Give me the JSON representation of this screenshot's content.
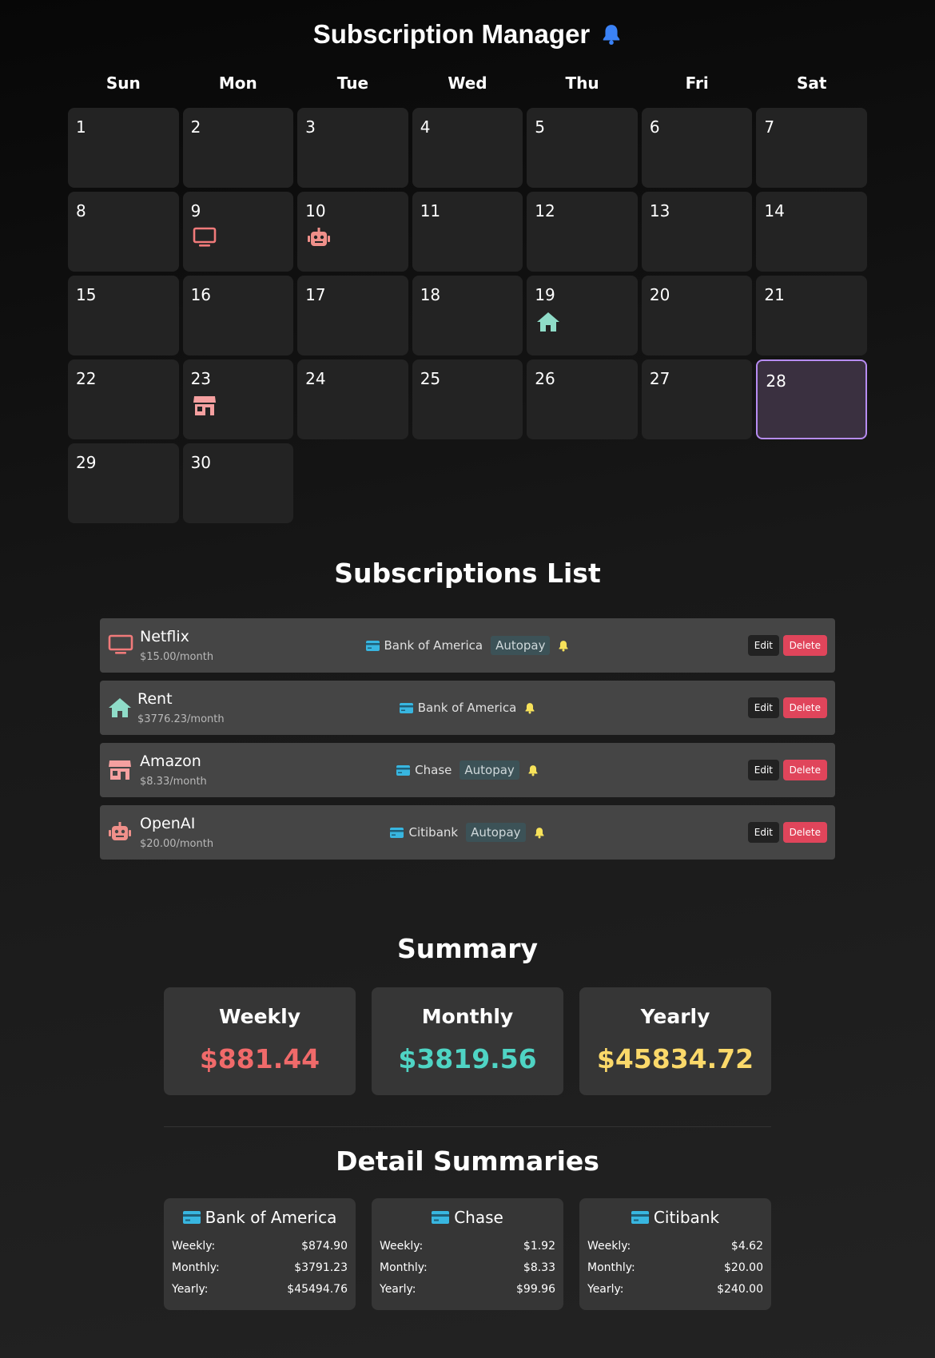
{
  "app": {
    "title": "Subscription Manager"
  },
  "calendar": {
    "weekdays": [
      "Sun",
      "Mon",
      "Tue",
      "Wed",
      "Thu",
      "Fri",
      "Sat"
    ],
    "days": [
      "1",
      "2",
      "3",
      "4",
      "5",
      "6",
      "7",
      "8",
      "9",
      "10",
      "11",
      "12",
      "13",
      "14",
      "15",
      "16",
      "17",
      "18",
      "19",
      "20",
      "21",
      "22",
      "23",
      "24",
      "25",
      "26",
      "27",
      "28",
      "29",
      "30"
    ],
    "events": [
      {
        "day": "9",
        "icon": "tv-icon",
        "color": "#f07a7a"
      },
      {
        "day": "10",
        "icon": "robot-icon",
        "color": "#f0908a"
      },
      {
        "day": "19",
        "icon": "home-icon",
        "color": "#8fdcc8"
      },
      {
        "day": "23",
        "icon": "store-icon",
        "color": "#f5a0a0"
      }
    ],
    "today": "28"
  },
  "subscriptions": {
    "title": "Subscriptions List",
    "items": [
      {
        "name": "Netflix",
        "price": "$15.00/month",
        "bank": "Bank of America",
        "autopay": "Autopay",
        "icon": "tv-icon",
        "icon_color": "#f07a7a"
      },
      {
        "name": "Rent",
        "price": "$3776.23/month",
        "bank": "Bank of America",
        "autopay": "",
        "icon": "home-icon",
        "icon_color": "#8fdcc8"
      },
      {
        "name": "Amazon",
        "price": "$8.33/month",
        "bank": "Chase",
        "autopay": "Autopay",
        "icon": "store-icon",
        "icon_color": "#f5a0a0"
      },
      {
        "name": "OpenAI",
        "price": "$20.00/month",
        "bank": "Citibank",
        "autopay": "Autopay",
        "icon": "robot-icon",
        "icon_color": "#f0908a"
      }
    ],
    "edit_label": "Edit",
    "delete_label": "Delete"
  },
  "summary": {
    "title": "Summary",
    "weekly_label": "Weekly",
    "weekly_value": "$881.44",
    "monthly_label": "Monthly",
    "monthly_value": "$3819.56",
    "yearly_label": "Yearly",
    "yearly_value": "$45834.72"
  },
  "details": {
    "title": "Detail Summaries",
    "weekly_label": "Weekly:",
    "monthly_label": "Monthly:",
    "yearly_label": "Yearly:",
    "cards": [
      {
        "bank": "Bank of America",
        "weekly": "$874.90",
        "monthly": "$3791.23",
        "yearly": "$45494.76"
      },
      {
        "bank": "Chase",
        "weekly": "$1.92",
        "monthly": "$8.33",
        "yearly": "$99.96"
      },
      {
        "bank": "Citibank",
        "weekly": "$4.62",
        "monthly": "$20.00",
        "yearly": "$240.00"
      }
    ]
  },
  "colors": {
    "accent_bell": "#3b82f6",
    "bell_small": "#f7e25a",
    "card_icon": "#38b6e0",
    "weekly_value": "#f06a6a",
    "monthly_value": "#4fd4c4",
    "yearly_value": "#fbd96a",
    "today_border": "#b78cf2",
    "delete_button": "#e0455b"
  }
}
